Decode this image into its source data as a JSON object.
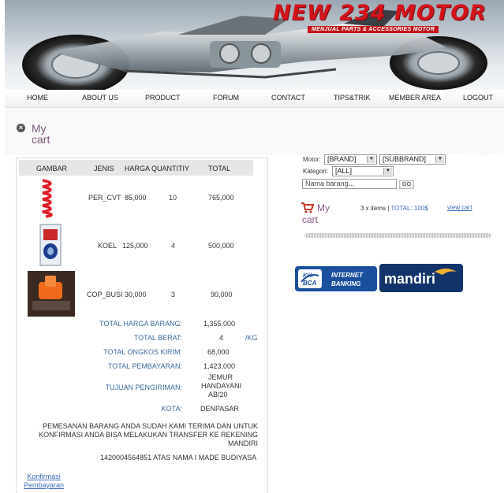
{
  "brand": {
    "title": "NEW 234 MOTOR",
    "tagline": "MENJUAL PARTS & ACCESSORIES MOTOR"
  },
  "nav": {
    "items": [
      {
        "label": "HOME"
      },
      {
        "label": "ABOUT US"
      },
      {
        "label": "PRODUCT"
      },
      {
        "label": "FORUM"
      },
      {
        "label": "CONTACT"
      },
      {
        "label": "TIPS&TRIK"
      },
      {
        "label": "MEMBER AREA"
      },
      {
        "label": "LOGOUT"
      }
    ]
  },
  "cart_heading": "My cart",
  "cart_table": {
    "headers": [
      "GAMBAR",
      "JENIS",
      "HARGA",
      "QUANTITIY",
      "TOTAL"
    ],
    "rows": [
      {
        "jenis": "PER_CVT",
        "harga": "85,000",
        "qty": "10",
        "total": "765,000"
      },
      {
        "jenis": "KOEL",
        "harga": "125,000",
        "qty": "4",
        "total": "500,000"
      },
      {
        "jenis": "COP_BUSI",
        "harga": "30,000",
        "qty": "3",
        "total": "90,000"
      }
    ]
  },
  "summary": {
    "total_harga_label": "TOTAL HARGA BARANG:",
    "total_harga_value": "1,355,000",
    "total_berat_label": "TOTAL BERAT:",
    "total_berat_value": "4",
    "total_berat_unit": "/KG",
    "ongkos_label": "TOTAL ONGKOS KIRIM:",
    "ongkos_value": "68,000",
    "pembayaran_label": "TOTAL PEMBAYARAN:",
    "pembayaran_value": "1,423,000",
    "tujuan_label": "TUJUAN PENGIRIMAN:",
    "tujuan_value_1": "JEMUR",
    "tujuan_value_2": "HANDAYANI",
    "tujuan_value_3": "AB/20",
    "kota_label": "KOTA:",
    "kota_value": "DENPASAR"
  },
  "message": {
    "line1": "PEMESANAN BARANG ANDA SUDAH KAMI TERIMA DAN UNTUK",
    "line2": "KONFIRMASI ANDA BISA MELAKUKAN TRANSFER KE REKENING",
    "line3": "MANDIRI",
    "line4": "1420004564851 ATAS NAMA I MADE BUDIYASA"
  },
  "confirm_link": {
    "line1": "Konfirmasi",
    "line2": "Pembayaran"
  },
  "search": {
    "motor_label": "Motor:",
    "brand_value": "[BRAND]",
    "subbrand_value": "[SUBBRAND]",
    "kategori_label": "Kategori:",
    "kategori_value": "[ALL]",
    "name_placeholder": "Nama barang...",
    "go_label": "GO"
  },
  "mini_cart": {
    "title_1": "My",
    "title_2": "cart",
    "items_text": "3 x items | ",
    "total_text": "TOTAL: 100$",
    "view_label": "view cart"
  },
  "banks": {
    "klik_1": "Klik",
    "klik_2": "BCA",
    "internet": "INTERNET",
    "banking": "BANKING",
    "mandiri": "mandiri"
  },
  "colors": {
    "brand_red": "#d4141b",
    "link_blue": "#3a6bb8",
    "label_blue": "#3a6a9a",
    "bca_blue": "#1a4f9e",
    "mandiri_navy": "#12346a",
    "mandiri_gold": "#f2b230"
  }
}
